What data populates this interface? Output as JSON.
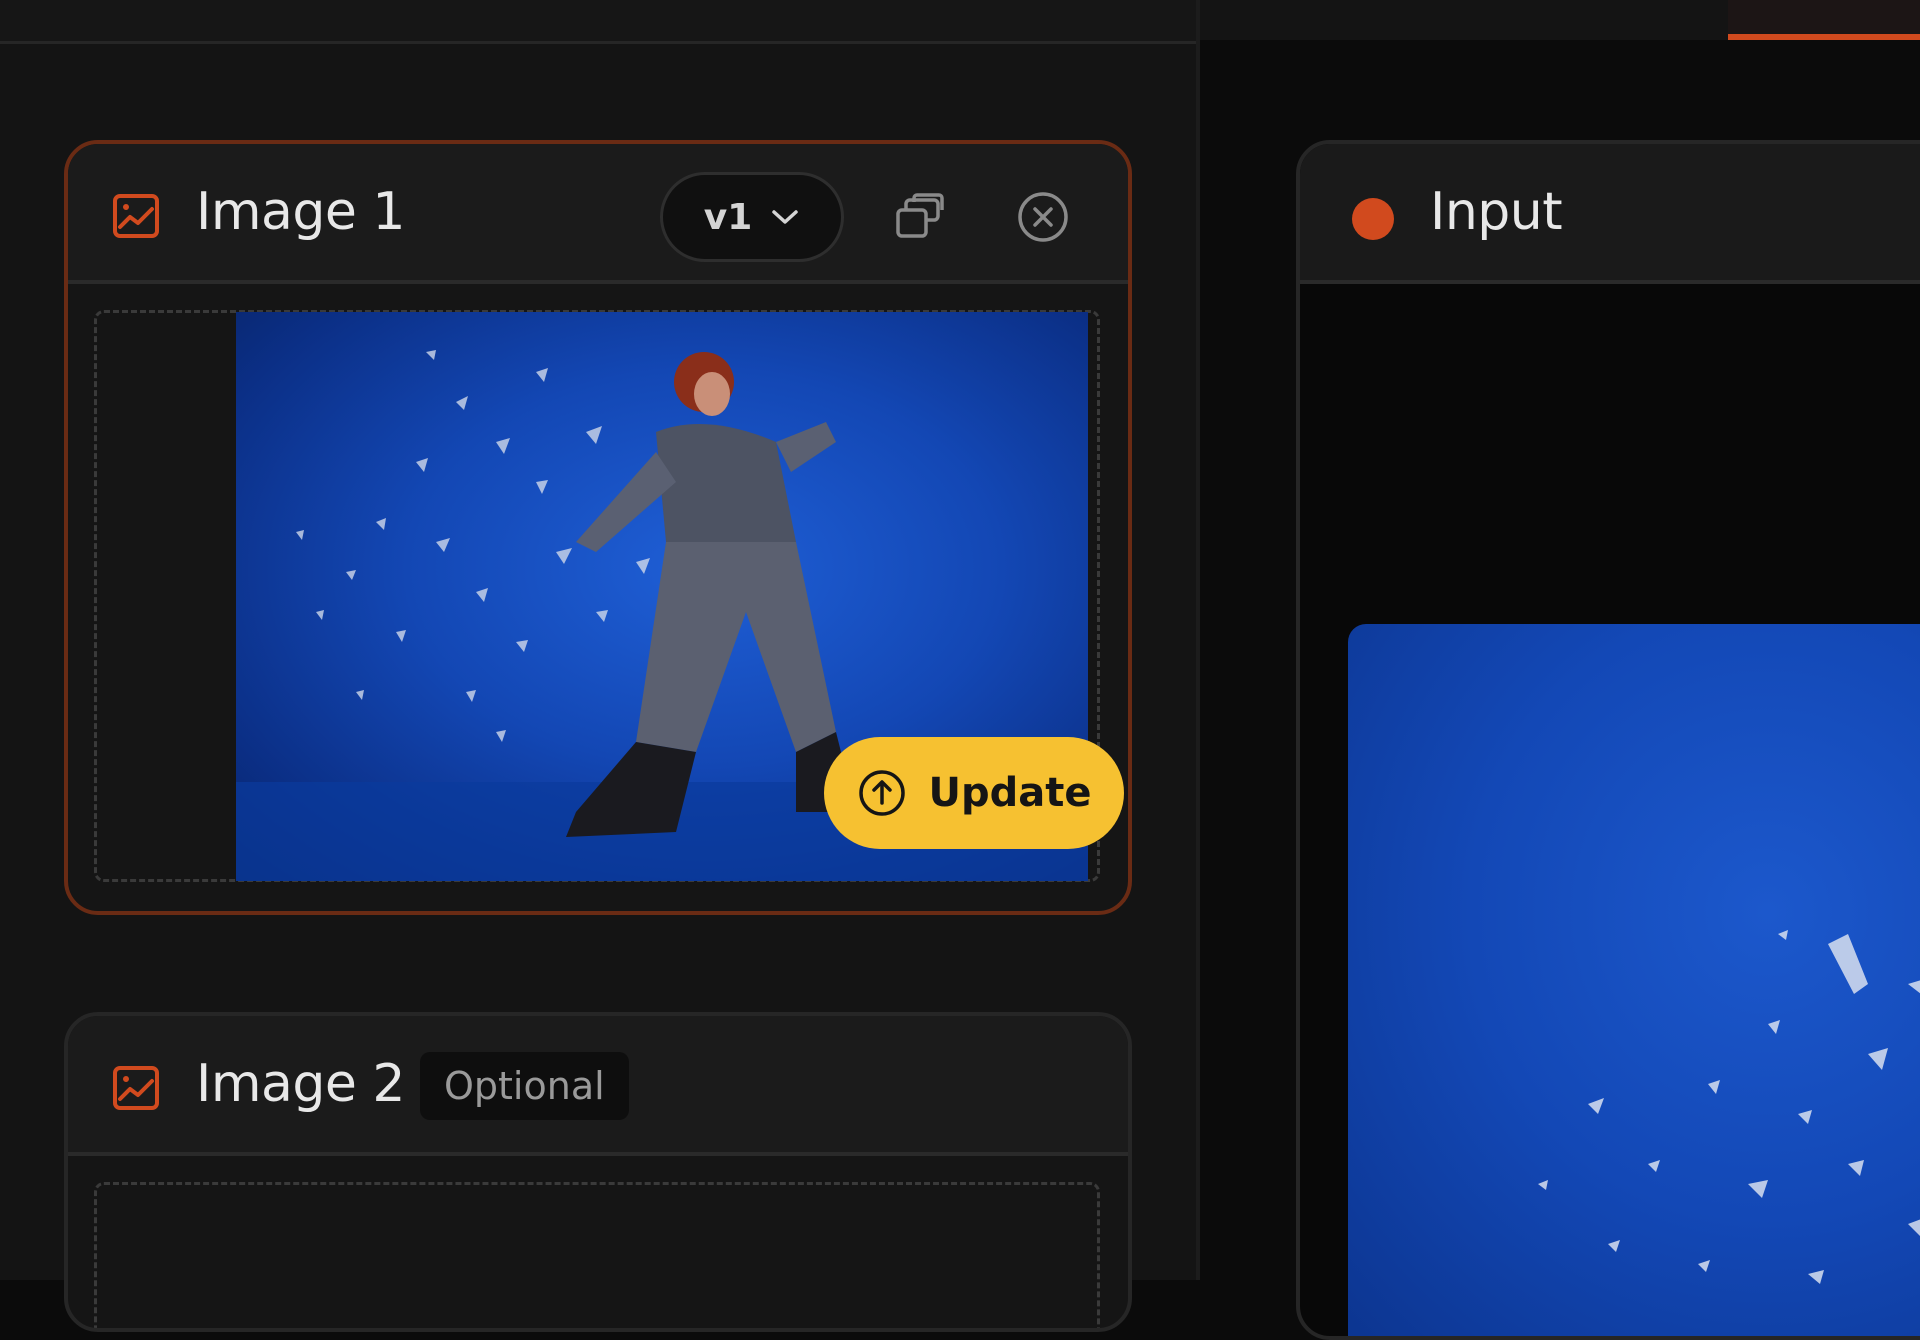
{
  "cards": {
    "image1": {
      "title": "Image 1",
      "version": "v1",
      "update_label": "Update"
    },
    "image2": {
      "title": "Image 2",
      "badge": "Optional"
    }
  },
  "input_panel": {
    "title": "Input"
  },
  "icons": {
    "image": "image-icon",
    "chevron": "chevron-down-icon",
    "copy": "copy-icon",
    "close": "close-circle-icon",
    "upload": "upload-circle-icon"
  },
  "colors": {
    "accent": "#d14a1e",
    "update_button": "#f6c131",
    "active_border": "#6a2b14"
  }
}
